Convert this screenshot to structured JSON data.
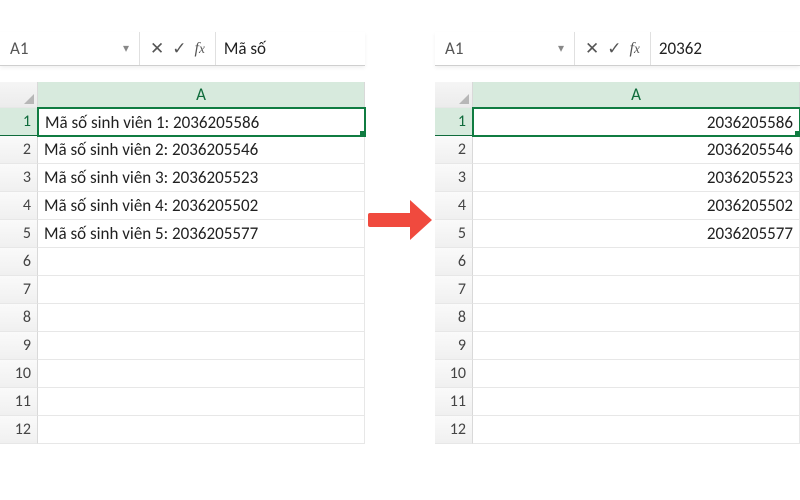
{
  "left": {
    "namebox": "A1",
    "formula_value": "Mã số",
    "col_label": "A",
    "cells": [
      "Mã số sinh viên 1: 2036205586",
      "Mã số sinh viên 2: 2036205546",
      "Mã số sinh viên 3: 2036205523",
      "Mã số sinh viên 4: 2036205502",
      "Mã số sinh viên 5: 2036205577",
      "",
      "",
      "",
      "",
      "",
      "",
      ""
    ],
    "align": "left"
  },
  "right": {
    "namebox": "A1",
    "formula_value": "20362",
    "col_label": "A",
    "cells": [
      "2036205586",
      "2036205546",
      "2036205523",
      "2036205502",
      "2036205577",
      "",
      "",
      "",
      "",
      "",
      "",
      ""
    ],
    "align": "right"
  },
  "row_count": 12
}
